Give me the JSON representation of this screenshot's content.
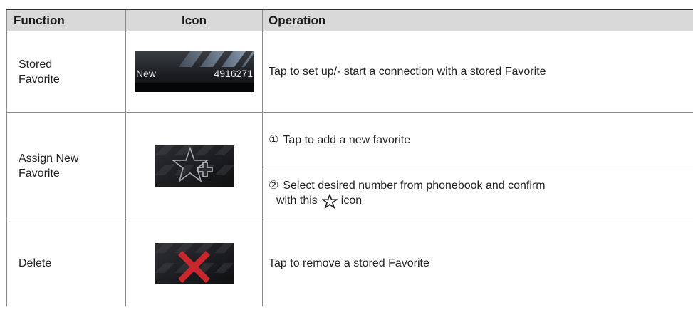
{
  "headers": {
    "function": "Function",
    "icon": "Icon",
    "operation": "Operation"
  },
  "rows": [
    {
      "function": "Stored\nFavorite",
      "icon_name": "stored-favorite-button-icon",
      "icon_text": {
        "label": "New",
        "number": "4916271"
      },
      "operation": "Tap to set up/- start a connection with a stored Favorite"
    },
    {
      "function": "Assign New\nFavorite",
      "icon_name": "star-plus-icon",
      "operations": [
        {
          "num": "①",
          "text": "Tap to add a new favorite"
        },
        {
          "num": "②",
          "text_line1": "Select desired number from phonebook and confirm",
          "text_line2_before": "with this",
          "text_line2_after": "icon",
          "inline_icon": "star-outline-icon"
        }
      ]
    },
    {
      "function": "Delete",
      "icon_name": "red-x-delete-icon",
      "operation": "Tap to remove a stored Favorite"
    }
  ],
  "colors": {
    "header_bg": "#d9d9d9",
    "border": "#8a8a8a",
    "text": "#231f20",
    "delete_red": "#c8282d"
  }
}
